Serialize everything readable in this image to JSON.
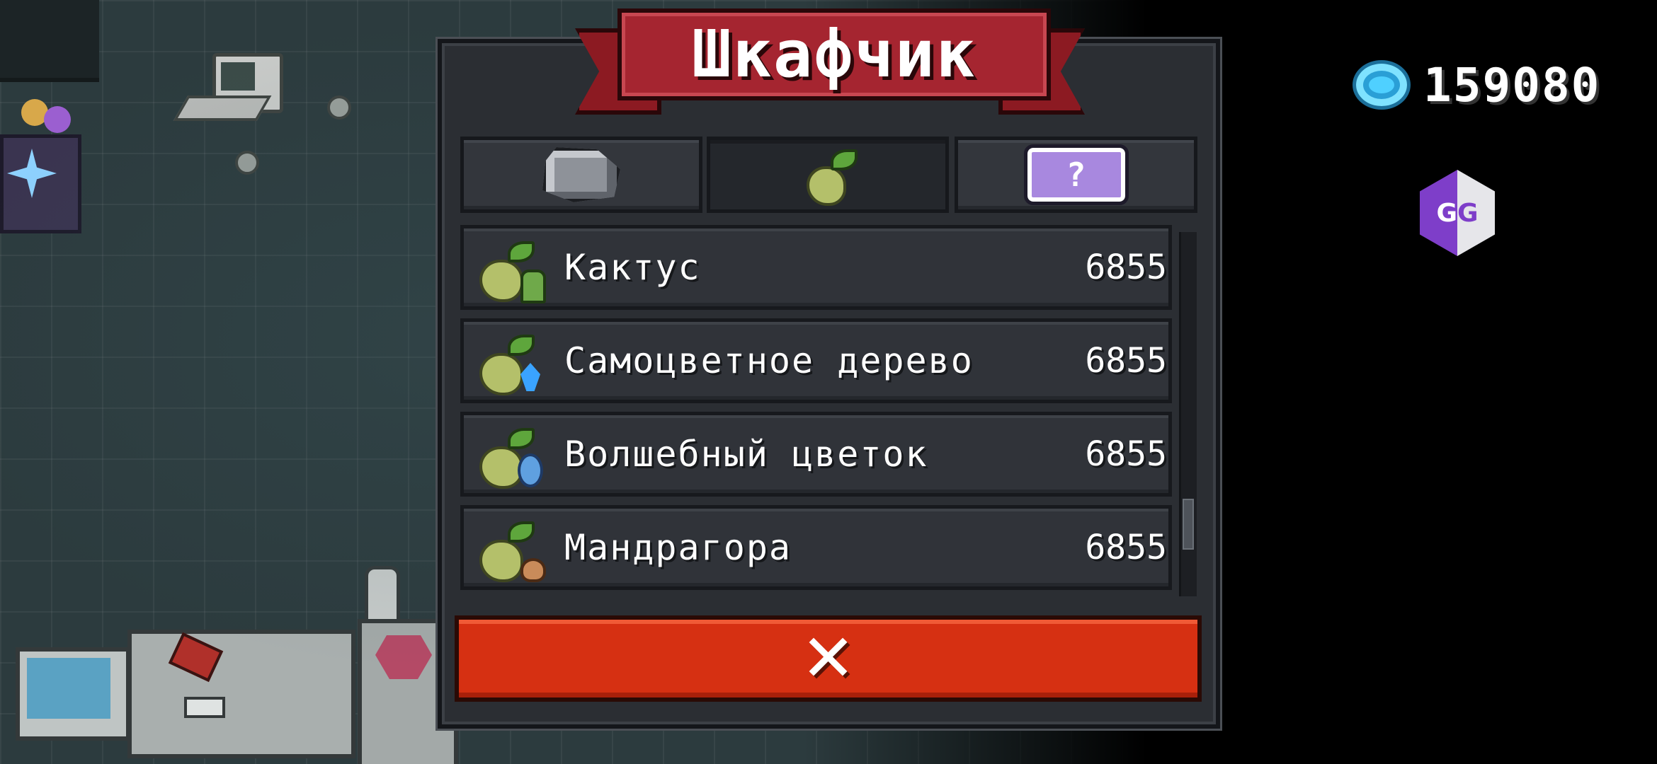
{
  "dialog": {
    "title": "Шкафчик",
    "tabs": [
      {
        "icon": "ore-icon",
        "active": false
      },
      {
        "icon": "seed-icon",
        "active": true
      },
      {
        "icon": "ticket-icon",
        "label": "?",
        "active": false
      }
    ],
    "items": [
      {
        "name": "Кактус",
        "count": "6855",
        "icon": "cactus-seed-icon"
      },
      {
        "name": "Самоцветное дерево",
        "count": "6855",
        "icon": "gem-tree-seed-icon"
      },
      {
        "name": "Волшебный цветок",
        "count": "6855",
        "icon": "magic-flower-seed-icon"
      },
      {
        "name": "Мандрагора",
        "count": "6855",
        "icon": "mandrake-seed-icon"
      }
    ],
    "scroll_position": 0.85,
    "close_label": "✕"
  },
  "hud": {
    "gems": "159080",
    "gem_icon": "gem-icon",
    "overlay_app": {
      "label_left": "G",
      "label_right": "G"
    }
  },
  "colors": {
    "banner_red": "#a52530",
    "close_button": "#d63012",
    "panel": "#2b2e33",
    "gem_blue": "#4fd0ff"
  }
}
